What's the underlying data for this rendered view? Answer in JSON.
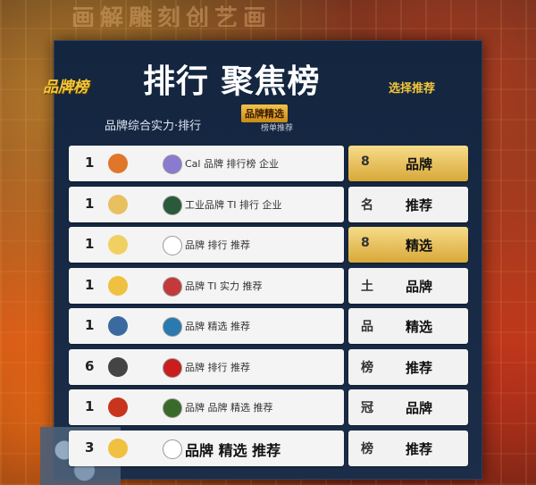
{
  "background": {
    "top_text": "画解雕刻创艺画"
  },
  "header": {
    "brand_left": "品牌榜",
    "title": "排行 聚焦榜",
    "brand_right": "选择推荐",
    "subtitle": "品牌综合实力·排行",
    "tag_badge": "品牌精选",
    "tag_sub": "榜单推荐"
  },
  "rows": [
    {
      "rank": "1",
      "logo_a_color": "#e0762a",
      "logo_b_color": "#8a7bd0",
      "text": "Cal 品牌 排行榜 企业",
      "big": false
    },
    {
      "rank": "1",
      "logo_a_color": "#e8c060",
      "logo_b_color": "#2a5a3a",
      "text": "工业品牌 TI 排行 企业",
      "big": false
    },
    {
      "rank": "1",
      "logo_a_color": "#f0d060",
      "logo_b_color": "#ffffff",
      "text": "品牌 排行 推荐",
      "big": false
    },
    {
      "rank": "1",
      "logo_a_color": "#f0c040",
      "logo_b_color": "#c43a3a",
      "text": "品牌 TI 实力 推荐",
      "big": false
    },
    {
      "rank": "1",
      "logo_a_color": "#3a6aa0",
      "logo_b_color": "#2a7ab0",
      "text": "品牌 精选 推荐",
      "big": false
    },
    {
      "rank": "6",
      "logo_a_color": "#444444",
      "logo_b_color": "#c81e1e",
      "text": "品牌 排行 推荐",
      "big": false
    },
    {
      "rank": "1",
      "logo_a_color": "#c8341e",
      "logo_b_color": "#3a6a2a",
      "text": "品牌 品牌 精选 推荐",
      "big": false
    },
    {
      "rank": "3",
      "logo_a_color": "#f0c040",
      "logo_b_color": "#ffffff",
      "text": "品牌 精选 推荐",
      "big": true
    }
  ],
  "side": [
    {
      "icon": "8",
      "label": "品牌",
      "gold": true
    },
    {
      "icon": "名",
      "label": "推荐",
      "gold": false
    },
    {
      "icon": "8",
      "label": "精选",
      "gold": true
    },
    {
      "icon": "土",
      "label": "品牌",
      "gold": false
    },
    {
      "icon": "品",
      "label": "精选",
      "gold": false
    },
    {
      "icon": "榜",
      "label": "推荐",
      "gold": false
    },
    {
      "icon": "冠",
      "label": "品牌",
      "gold": false
    },
    {
      "icon": "榜",
      "label": "推荐",
      "gold": false
    }
  ]
}
